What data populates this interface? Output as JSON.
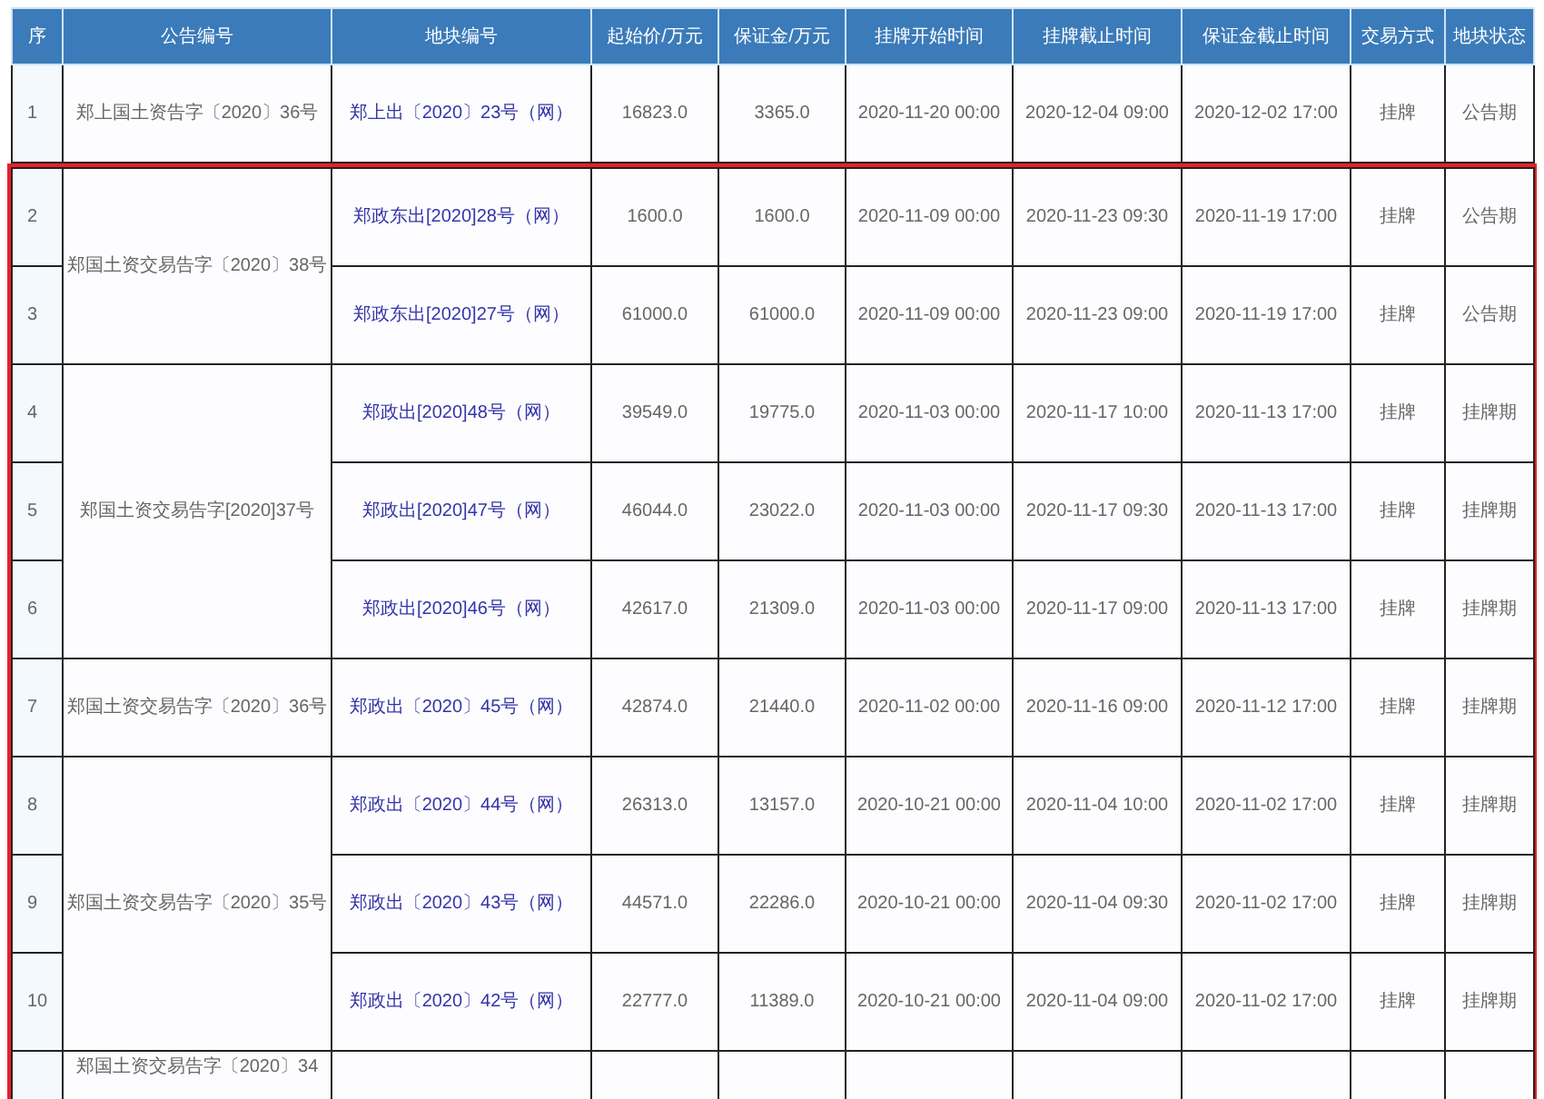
{
  "table": {
    "columns": [
      "序",
      "公告编号",
      "地块编号",
      "起始价/万元",
      "保证金/万元",
      "挂牌开始时间",
      "挂牌截止时间",
      "保证金截止时间",
      "交易方式",
      "地块状态"
    ],
    "groups": [
      {
        "announcement": "郑上国土资告字〔2020〕36号",
        "highlighted": false,
        "lots": [
          {
            "seq": "1",
            "lot": "郑上出〔2020〕23号（网）",
            "start_price": "16823.0",
            "deposit": "3365.0",
            "listing_start": "2020-11-20 00:00",
            "listing_end": "2020-12-04 09:00",
            "deposit_deadline": "2020-12-02 17:00",
            "method": "挂牌",
            "status": "公告期"
          }
        ]
      },
      {
        "announcement": "郑国土资交易告字〔2020〕38号",
        "highlighted": true,
        "lots": [
          {
            "seq": "2",
            "lot": "郑政东出[2020]28号（网）",
            "start_price": "1600.0",
            "deposit": "1600.0",
            "listing_start": "2020-11-09 00:00",
            "listing_end": "2020-11-23 09:30",
            "deposit_deadline": "2020-11-19 17:00",
            "method": "挂牌",
            "status": "公告期"
          },
          {
            "seq": "3",
            "lot": "郑政东出[2020]27号（网）",
            "start_price": "61000.0",
            "deposit": "61000.0",
            "listing_start": "2020-11-09 00:00",
            "listing_end": "2020-11-23 09:00",
            "deposit_deadline": "2020-11-19 17:00",
            "method": "挂牌",
            "status": "公告期"
          }
        ]
      },
      {
        "announcement": "郑国土资交易告字[2020]37号",
        "highlighted": true,
        "lots": [
          {
            "seq": "4",
            "lot": "郑政出[2020]48号（网）",
            "start_price": "39549.0",
            "deposit": "19775.0",
            "listing_start": "2020-11-03 00:00",
            "listing_end": "2020-11-17 10:00",
            "deposit_deadline": "2020-11-13 17:00",
            "method": "挂牌",
            "status": "挂牌期"
          },
          {
            "seq": "5",
            "lot": "郑政出[2020]47号（网）",
            "start_price": "46044.0",
            "deposit": "23022.0",
            "listing_start": "2020-11-03 00:00",
            "listing_end": "2020-11-17 09:30",
            "deposit_deadline": "2020-11-13 17:00",
            "method": "挂牌",
            "status": "挂牌期"
          },
          {
            "seq": "6",
            "lot": "郑政出[2020]46号（网）",
            "start_price": "42617.0",
            "deposit": "21309.0",
            "listing_start": "2020-11-03 00:00",
            "listing_end": "2020-11-17 09:00",
            "deposit_deadline": "2020-11-13 17:00",
            "method": "挂牌",
            "status": "挂牌期"
          }
        ]
      },
      {
        "announcement": "郑国土资交易告字〔2020〕36号",
        "highlighted": true,
        "lots": [
          {
            "seq": "7",
            "lot": "郑政出〔2020〕45号（网）",
            "start_price": "42874.0",
            "deposit": "21440.0",
            "listing_start": "2020-11-02 00:00",
            "listing_end": "2020-11-16 09:00",
            "deposit_deadline": "2020-11-12 17:00",
            "method": "挂牌",
            "status": "挂牌期"
          }
        ]
      },
      {
        "announcement": "郑国土资交易告字〔2020〕35号",
        "highlighted": true,
        "lots": [
          {
            "seq": "8",
            "lot": "郑政出〔2020〕44号（网）",
            "start_price": "26313.0",
            "deposit": "13157.0",
            "listing_start": "2020-10-21 00:00",
            "listing_end": "2020-11-04 10:00",
            "deposit_deadline": "2020-11-02 17:00",
            "method": "挂牌",
            "status": "挂牌期"
          },
          {
            "seq": "9",
            "lot": "郑政出〔2020〕43号（网）",
            "start_price": "44571.0",
            "deposit": "22286.0",
            "listing_start": "2020-10-21 00:00",
            "listing_end": "2020-11-04 09:30",
            "deposit_deadline": "2020-11-02 17:00",
            "method": "挂牌",
            "status": "挂牌期"
          },
          {
            "seq": "10",
            "lot": "郑政出〔2020〕42号（网）",
            "start_price": "22777.0",
            "deposit": "11389.0",
            "listing_start": "2020-10-21 00:00",
            "listing_end": "2020-11-04 09:00",
            "deposit_deadline": "2020-11-02 17:00",
            "method": "挂牌",
            "status": "挂牌期"
          }
        ]
      },
      {
        "announcement": "郑国土资交易告字〔2020〕34",
        "highlighted": true
      }
    ]
  }
}
